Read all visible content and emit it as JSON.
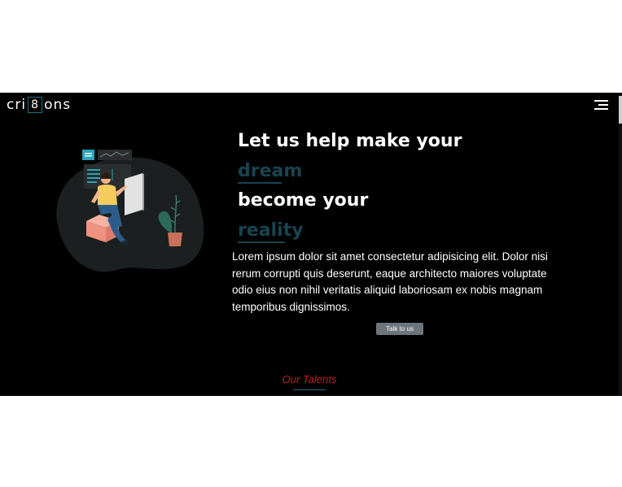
{
  "brand": {
    "prefix": "cri",
    "number": "8",
    "suffix": "ons"
  },
  "nav": {
    "menu_icon": "hamburger-icon"
  },
  "hero": {
    "line1": "Let us help make your",
    "accent1": "dream",
    "line2": "become your",
    "accent2": "reality",
    "paragraph": "Lorem ipsum dolor sit amet consectetur adipisicing elit. Dolor nisi rerum corrupti quis deserunt, eaque architecto maiores voluptate odio eius non nihil veritatis aliquid laboriosam ex nobis magnam temporibus dignissimos.",
    "cta_label": "Talk to us",
    "illustration": "person-with-dashboard-illustration"
  },
  "talents": {
    "title": "Our Talents"
  },
  "colors": {
    "page_bg": "#ffffff",
    "site_bg": "#000000",
    "accent_text": "#17444f",
    "brand_teal": "#1f6f86",
    "cta_bg": "#6c757d",
    "section_title": "#c22020"
  }
}
